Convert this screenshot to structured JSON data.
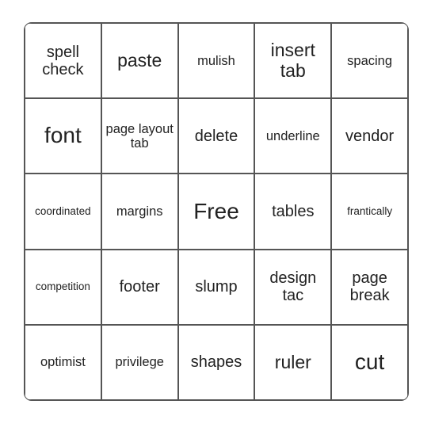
{
  "bingo": {
    "cells": [
      [
        {
          "text": "spell check",
          "size": "m"
        },
        {
          "text": "paste",
          "size": "l"
        },
        {
          "text": "mulish",
          "size": "s"
        },
        {
          "text": "insert tab",
          "size": "l"
        },
        {
          "text": "spacing",
          "size": "s"
        }
      ],
      [
        {
          "text": "font",
          "size": "xl"
        },
        {
          "text": "page layout tab",
          "size": "s"
        },
        {
          "text": "delete",
          "size": "m"
        },
        {
          "text": "underline",
          "size": "s"
        },
        {
          "text": "vendor",
          "size": "m"
        }
      ],
      [
        {
          "text": "coordinated",
          "size": "xs"
        },
        {
          "text": "margins",
          "size": "s"
        },
        {
          "text": "Free",
          "size": "xl"
        },
        {
          "text": "tables",
          "size": "m"
        },
        {
          "text": "frantically",
          "size": "xs"
        }
      ],
      [
        {
          "text": "competition",
          "size": "xs"
        },
        {
          "text": "footer",
          "size": "m"
        },
        {
          "text": "slump",
          "size": "m"
        },
        {
          "text": "design tac",
          "size": "m"
        },
        {
          "text": "page break",
          "size": "m"
        }
      ],
      [
        {
          "text": "optimist",
          "size": "s"
        },
        {
          "text": "privilege",
          "size": "s"
        },
        {
          "text": "shapes",
          "size": "m"
        },
        {
          "text": "ruler",
          "size": "l"
        },
        {
          "text": "cut",
          "size": "xl"
        }
      ]
    ]
  }
}
